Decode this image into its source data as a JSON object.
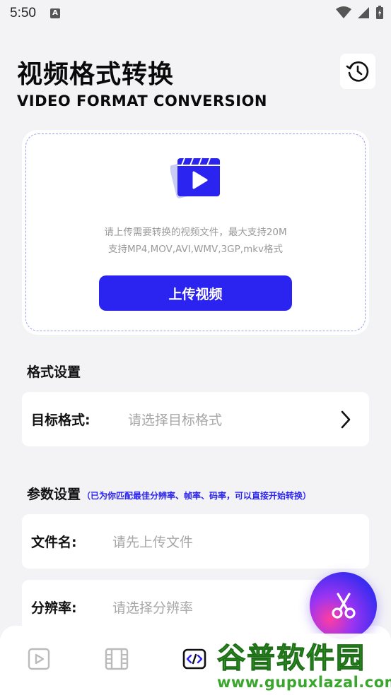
{
  "status_bar": {
    "time": "5:50",
    "indicator": "A"
  },
  "header": {
    "title": "视频格式转换",
    "subtitle": "VIDEO FORMAT CONVERSION",
    "history_icon": "clock-history-icon"
  },
  "upload": {
    "hint_line1": "请上传需要转换的视频文件，最大支持20M",
    "hint_line2": "支持MP4,MOV,AVI,WMV,3GP,mkv格式",
    "button_label": "上传视频"
  },
  "format_section": {
    "title": "格式设置",
    "target_label": "目标格式:",
    "target_placeholder": "请选择目标格式"
  },
  "params_section": {
    "title": "参数设置",
    "note": "（已为你匹配最佳分辨率、帧率、码率，可以直接开始转换）",
    "filename_label": "文件名:",
    "filename_placeholder": "请先上传文件",
    "resolution_label": "分辨率:",
    "resolution_placeholder": "请选择分辨率"
  },
  "bottom_nav": {
    "items": [
      {
        "icon": "play-square-icon",
        "active": false
      },
      {
        "icon": "film-strip-icon",
        "active": false
      },
      {
        "icon": "code-icon",
        "active": true
      }
    ]
  },
  "fab": {
    "icon": "scissors-icon"
  },
  "watermark": {
    "title": "谷普软件园",
    "url": "www.gupuxlazal.com"
  },
  "colors": {
    "accent": "#2b24f0",
    "background": "#f3f3f6",
    "watermark_green": "#35a12a"
  }
}
